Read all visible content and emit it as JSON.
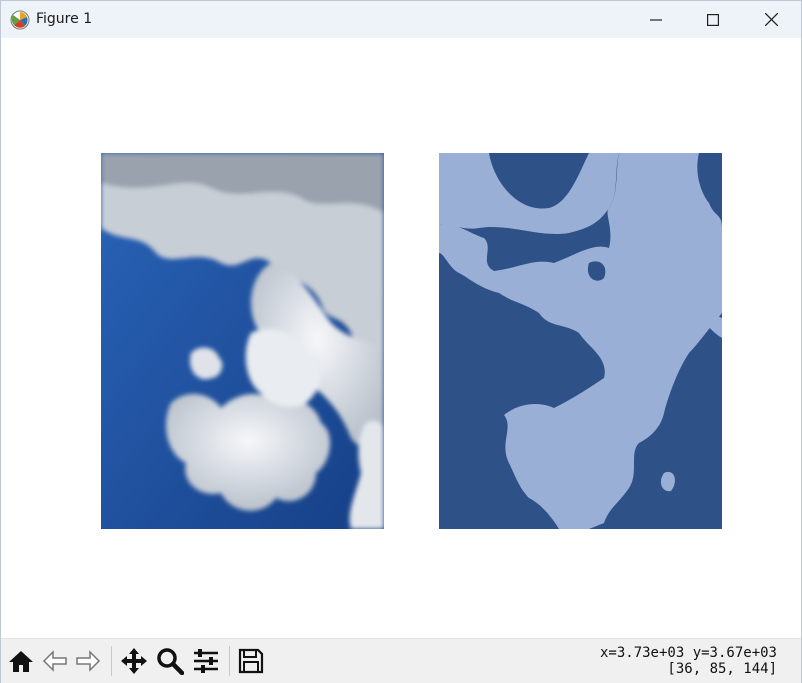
{
  "window": {
    "title": "Figure 1",
    "icon": "matplotlib-icon",
    "controls": [
      "minimize-icon",
      "maximize-icon",
      "close-icon"
    ]
  },
  "figure": {
    "images": [
      {
        "name": "original-photo",
        "description_colors": {
          "sky": "#1c4f9c",
          "cloud": "#e6e9ee"
        }
      },
      {
        "name": "segmented-image",
        "description_colors": {
          "sky": "#2e5187",
          "cloud": "#99afd6"
        }
      }
    ]
  },
  "toolbar": {
    "buttons": [
      "home-icon",
      "back-icon",
      "forward-icon",
      "pan-icon",
      "zoom-icon",
      "configure-subplots-icon",
      "save-icon"
    ],
    "coords_line1": "x=3.73e+03 y=3.67e+03",
    "coords_line2": "[36, 85, 144]"
  }
}
